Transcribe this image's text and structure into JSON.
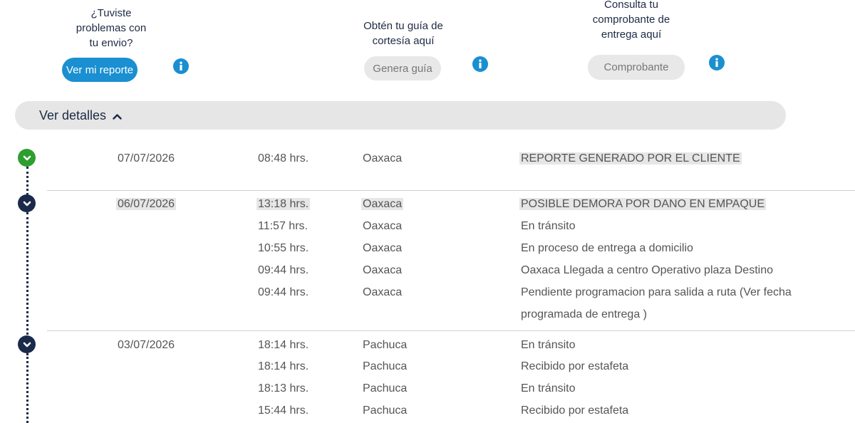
{
  "actions": {
    "report": {
      "caption_lines": [
        "¿Tuviste",
        "problemas con",
        "tu envio?"
      ],
      "button": "Ver mi reporte"
    },
    "guide": {
      "caption_lines": [
        "Obtén tu guía de",
        "cortesía aquí"
      ],
      "button": "Genera guía"
    },
    "receipt": {
      "caption_lines": [
        "Consulta tu",
        "comprobante de",
        "entrega aquí"
      ],
      "button": "Comprobante"
    }
  },
  "details": {
    "label": "Ver detalles"
  },
  "groups": [
    {
      "date": "07/07/2026",
      "status": "completed",
      "events": [
        {
          "time": "08:48 hrs.",
          "place": "Oaxaca",
          "desc": "REPORTE GENERADO POR EL CLIENTE"
        }
      ]
    },
    {
      "date": "06/07/2026",
      "status": "expanded",
      "events": [
        {
          "time": "13:18 hrs.",
          "place": "Oaxaca",
          "desc": "POSIBLE DEMORA POR DANO EN EMPAQUE"
        },
        {
          "time": "11:57 hrs.",
          "place": "Oaxaca",
          "desc": "En tránsito"
        },
        {
          "time": "10:55 hrs.",
          "place": "Oaxaca",
          "desc": "En proceso de entrega a domicilio"
        },
        {
          "time": "09:44 hrs.",
          "place": "Oaxaca",
          "desc": "Oaxaca Llegada a centro Operativo plaza Destino"
        },
        {
          "time": "09:44 hrs.",
          "place": "Oaxaca",
          "desc": "Pendiente programacion para salida a ruta (Ver fecha programada de entrega )"
        }
      ]
    },
    {
      "date": "03/07/2026",
      "status": "expanded",
      "events": [
        {
          "time": "18:14 hrs.",
          "place": "Pachuca",
          "desc": "En tránsito"
        },
        {
          "time": "18:14 hrs.",
          "place": "Pachuca",
          "desc": "Recibido por estafeta"
        },
        {
          "time": "18:13 hrs.",
          "place": "Pachuca",
          "desc": "En tránsito"
        },
        {
          "time": "15:44 hrs.",
          "place": "Pachuca",
          "desc": "Recibido por estafeta"
        }
      ]
    }
  ],
  "colors": {
    "accent": "#1a8fd1",
    "navy": "#1b2a4a",
    "success": "#2e9e2e"
  }
}
